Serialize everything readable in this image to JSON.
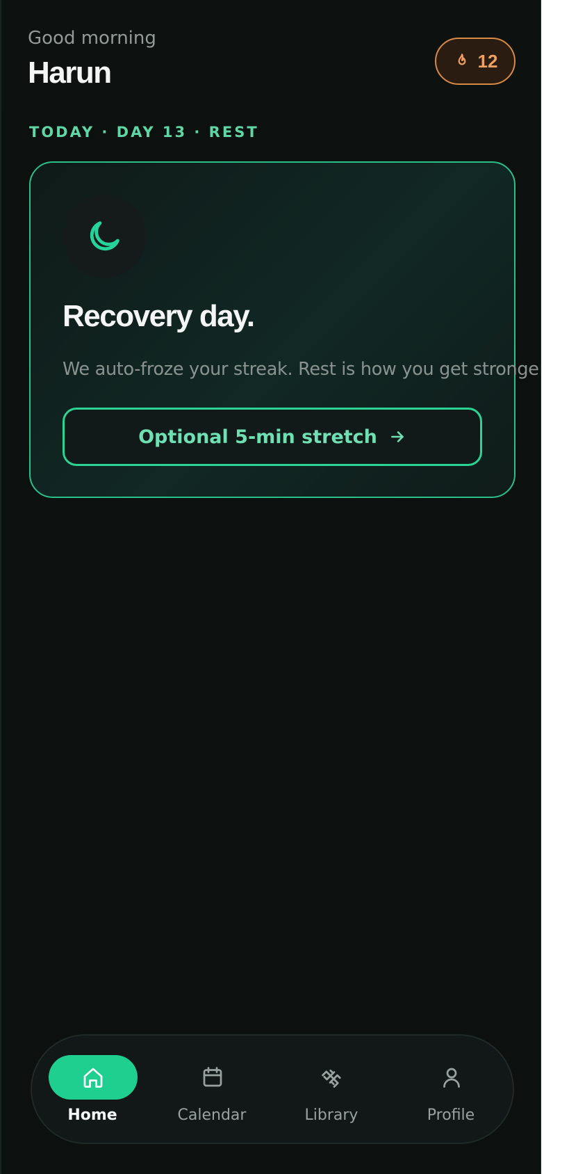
{
  "header": {
    "greeting": "Good morning",
    "user_name": "Harun",
    "streak": {
      "count": "12",
      "icon": "flame-icon"
    }
  },
  "today": {
    "label": "TODAY · DAY 13 · REST"
  },
  "recovery_card": {
    "icon": "moon-icon",
    "title": "Recovery day.",
    "body": "We auto-froze your streak. Rest is how you get stronger.",
    "button": {
      "label": "Optional 5-min stretch",
      "icon": "arrow-right-icon"
    }
  },
  "tabs": [
    {
      "label": "Home",
      "icon": "home-icon",
      "active": true
    },
    {
      "label": "Calendar",
      "icon": "calendar-icon",
      "active": false
    },
    {
      "label": "Library",
      "icon": "dumbbell-icon",
      "active": false
    },
    {
      "label": "Profile",
      "icon": "user-icon",
      "active": false
    }
  ],
  "colors": {
    "accent": "#1fcf8f",
    "streak": "#f0a060",
    "background": "#0c100f"
  }
}
